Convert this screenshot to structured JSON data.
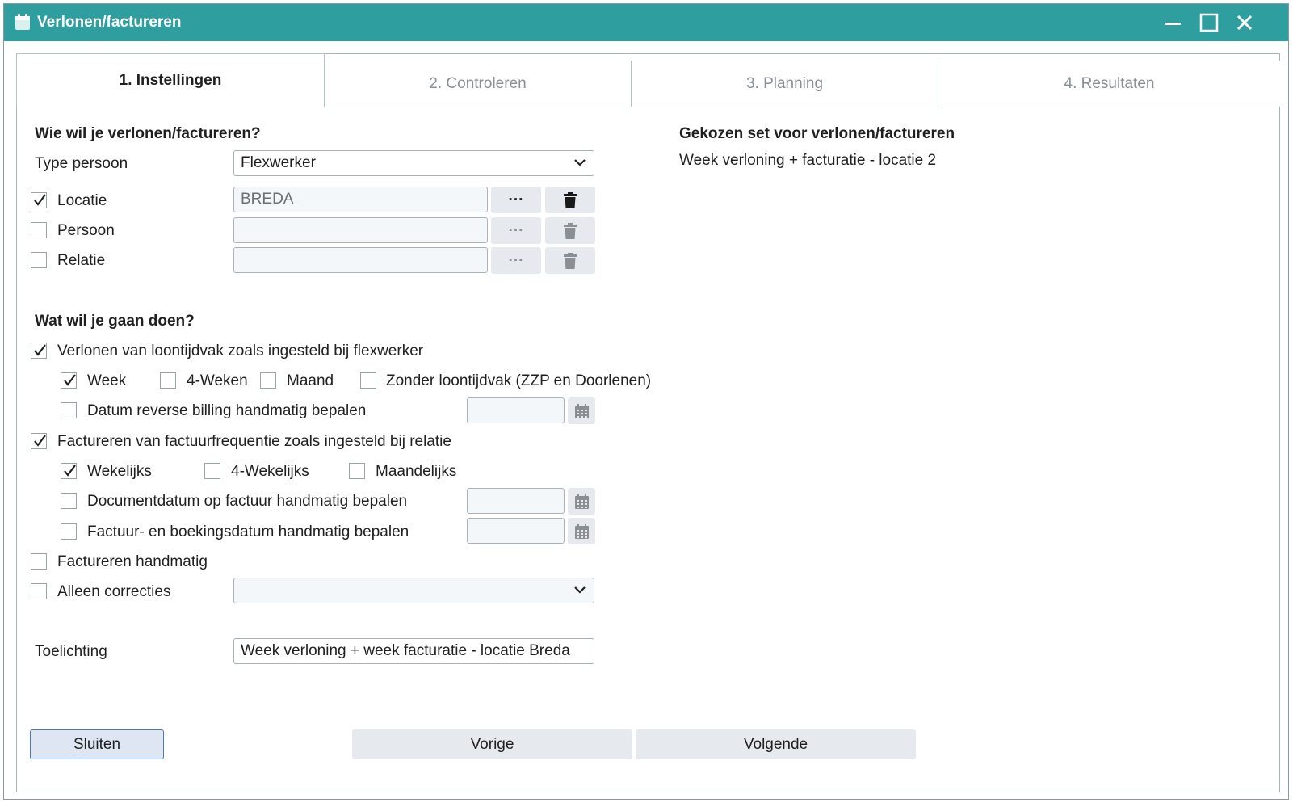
{
  "window": {
    "title": "Verlonen/factureren",
    "title_icon": "calendar-icon",
    "controls": [
      "minimize-icon",
      "maximize-icon",
      "close-icon"
    ],
    "accent_color": "#2e9e9e"
  },
  "tabs": [
    {
      "label": "1. Instellingen",
      "active": true
    },
    {
      "label": "2. Controleren",
      "active": false
    },
    {
      "label": "3. Planning",
      "active": false
    },
    {
      "label": "4. Resultaten",
      "active": false
    }
  ],
  "section_who": {
    "heading": "Wie wil je verlonen/factureren?",
    "type_persoon": {
      "label": "Type persoon",
      "value": "Flexwerker"
    },
    "locatie": {
      "label": "Locatie",
      "checked": true,
      "value": "BREDA"
    },
    "persoon": {
      "label": "Persoon",
      "checked": false,
      "value": ""
    },
    "relatie": {
      "label": "Relatie",
      "checked": false,
      "value": ""
    },
    "lookup_button_label": "···"
  },
  "section_what": {
    "heading": "Wat wil je gaan doen?",
    "verlonen": {
      "label": "Verlonen van loontijdvak zoals ingesteld bij flexwerker",
      "checked": true
    },
    "periods": [
      {
        "label": "Week",
        "checked": true
      },
      {
        "label": "4-Weken",
        "checked": false
      },
      {
        "label": "Maand",
        "checked": false
      },
      {
        "label": "Zonder loontijdvak (ZZP en Doorlenen)",
        "checked": false
      }
    ],
    "datum_reverse": {
      "label": "Datum reverse billing handmatig bepalen",
      "checked": false,
      "value": ""
    },
    "factureren": {
      "label": "Factureren van factuurfrequentie zoals ingesteld bij relatie",
      "checked": true
    },
    "frequencies": [
      {
        "label": "Wekelijks",
        "checked": true
      },
      {
        "label": "4-Wekelijks",
        "checked": false
      },
      {
        "label": "Maandelijks",
        "checked": false
      }
    ],
    "documentdatum": {
      "label": "Documentdatum op factuur handmatig bepalen",
      "checked": false,
      "value": ""
    },
    "factuurdatum": {
      "label": "Factuur- en boekingsdatum handmatig bepalen",
      "checked": false,
      "value": ""
    },
    "handmatig": {
      "label": "Factureren handmatig",
      "checked": false
    },
    "correcties": {
      "label": "Alleen correcties",
      "checked": false,
      "value": ""
    }
  },
  "toelichting": {
    "label": "Toelichting",
    "value": "Week verloning + week facturatie - locatie Breda"
  },
  "right_panel": {
    "heading": "Gekozen set voor verlonen/factureren",
    "value": "Week verloning + facturatie - locatie 2"
  },
  "footer": {
    "close_label_underlined": "S",
    "close_label_rest": "luiten",
    "prev_label": "Vorige",
    "next_label": "Volgende"
  }
}
